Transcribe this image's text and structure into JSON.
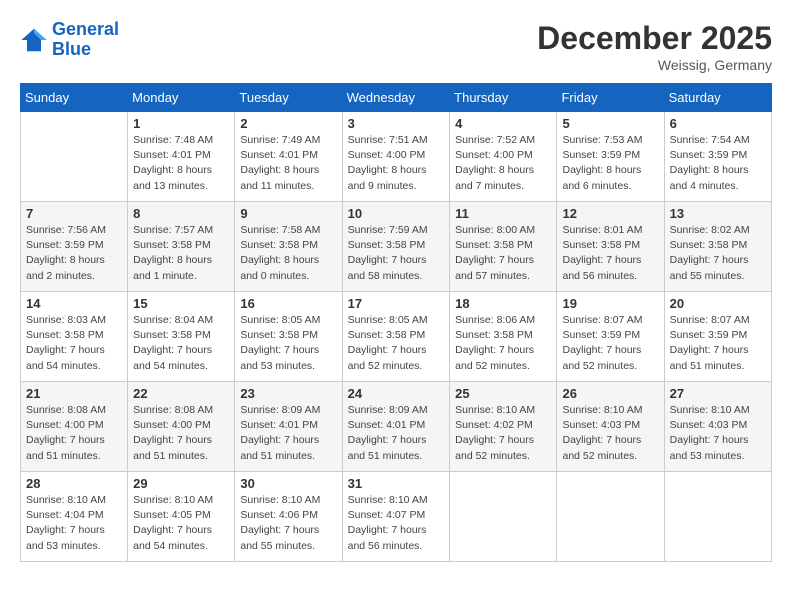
{
  "logo": {
    "line1": "General",
    "line2": "Blue"
  },
  "title": "December 2025",
  "subtitle": "Weissig, Germany",
  "days_of_week": [
    "Sunday",
    "Monday",
    "Tuesday",
    "Wednesday",
    "Thursday",
    "Friday",
    "Saturday"
  ],
  "weeks": [
    [
      {
        "day": "",
        "info": ""
      },
      {
        "day": "1",
        "info": "Sunrise: 7:48 AM\nSunset: 4:01 PM\nDaylight: 8 hours\nand 13 minutes."
      },
      {
        "day": "2",
        "info": "Sunrise: 7:49 AM\nSunset: 4:01 PM\nDaylight: 8 hours\nand 11 minutes."
      },
      {
        "day": "3",
        "info": "Sunrise: 7:51 AM\nSunset: 4:00 PM\nDaylight: 8 hours\nand 9 minutes."
      },
      {
        "day": "4",
        "info": "Sunrise: 7:52 AM\nSunset: 4:00 PM\nDaylight: 8 hours\nand 7 minutes."
      },
      {
        "day": "5",
        "info": "Sunrise: 7:53 AM\nSunset: 3:59 PM\nDaylight: 8 hours\nand 6 minutes."
      },
      {
        "day": "6",
        "info": "Sunrise: 7:54 AM\nSunset: 3:59 PM\nDaylight: 8 hours\nand 4 minutes."
      }
    ],
    [
      {
        "day": "7",
        "info": "Sunrise: 7:56 AM\nSunset: 3:59 PM\nDaylight: 8 hours\nand 2 minutes."
      },
      {
        "day": "8",
        "info": "Sunrise: 7:57 AM\nSunset: 3:58 PM\nDaylight: 8 hours\nand 1 minute."
      },
      {
        "day": "9",
        "info": "Sunrise: 7:58 AM\nSunset: 3:58 PM\nDaylight: 8 hours\nand 0 minutes."
      },
      {
        "day": "10",
        "info": "Sunrise: 7:59 AM\nSunset: 3:58 PM\nDaylight: 7 hours\nand 58 minutes."
      },
      {
        "day": "11",
        "info": "Sunrise: 8:00 AM\nSunset: 3:58 PM\nDaylight: 7 hours\nand 57 minutes."
      },
      {
        "day": "12",
        "info": "Sunrise: 8:01 AM\nSunset: 3:58 PM\nDaylight: 7 hours\nand 56 minutes."
      },
      {
        "day": "13",
        "info": "Sunrise: 8:02 AM\nSunset: 3:58 PM\nDaylight: 7 hours\nand 55 minutes."
      }
    ],
    [
      {
        "day": "14",
        "info": "Sunrise: 8:03 AM\nSunset: 3:58 PM\nDaylight: 7 hours\nand 54 minutes."
      },
      {
        "day": "15",
        "info": "Sunrise: 8:04 AM\nSunset: 3:58 PM\nDaylight: 7 hours\nand 54 minutes."
      },
      {
        "day": "16",
        "info": "Sunrise: 8:05 AM\nSunset: 3:58 PM\nDaylight: 7 hours\nand 53 minutes."
      },
      {
        "day": "17",
        "info": "Sunrise: 8:05 AM\nSunset: 3:58 PM\nDaylight: 7 hours\nand 52 minutes."
      },
      {
        "day": "18",
        "info": "Sunrise: 8:06 AM\nSunset: 3:58 PM\nDaylight: 7 hours\nand 52 minutes."
      },
      {
        "day": "19",
        "info": "Sunrise: 8:07 AM\nSunset: 3:59 PM\nDaylight: 7 hours\nand 52 minutes."
      },
      {
        "day": "20",
        "info": "Sunrise: 8:07 AM\nSunset: 3:59 PM\nDaylight: 7 hours\nand 51 minutes."
      }
    ],
    [
      {
        "day": "21",
        "info": "Sunrise: 8:08 AM\nSunset: 4:00 PM\nDaylight: 7 hours\nand 51 minutes."
      },
      {
        "day": "22",
        "info": "Sunrise: 8:08 AM\nSunset: 4:00 PM\nDaylight: 7 hours\nand 51 minutes."
      },
      {
        "day": "23",
        "info": "Sunrise: 8:09 AM\nSunset: 4:01 PM\nDaylight: 7 hours\nand 51 minutes."
      },
      {
        "day": "24",
        "info": "Sunrise: 8:09 AM\nSunset: 4:01 PM\nDaylight: 7 hours\nand 51 minutes."
      },
      {
        "day": "25",
        "info": "Sunrise: 8:10 AM\nSunset: 4:02 PM\nDaylight: 7 hours\nand 52 minutes."
      },
      {
        "day": "26",
        "info": "Sunrise: 8:10 AM\nSunset: 4:03 PM\nDaylight: 7 hours\nand 52 minutes."
      },
      {
        "day": "27",
        "info": "Sunrise: 8:10 AM\nSunset: 4:03 PM\nDaylight: 7 hours\nand 53 minutes."
      }
    ],
    [
      {
        "day": "28",
        "info": "Sunrise: 8:10 AM\nSunset: 4:04 PM\nDaylight: 7 hours\nand 53 minutes."
      },
      {
        "day": "29",
        "info": "Sunrise: 8:10 AM\nSunset: 4:05 PM\nDaylight: 7 hours\nand 54 minutes."
      },
      {
        "day": "30",
        "info": "Sunrise: 8:10 AM\nSunset: 4:06 PM\nDaylight: 7 hours\nand 55 minutes."
      },
      {
        "day": "31",
        "info": "Sunrise: 8:10 AM\nSunset: 4:07 PM\nDaylight: 7 hours\nand 56 minutes."
      },
      {
        "day": "",
        "info": ""
      },
      {
        "day": "",
        "info": ""
      },
      {
        "day": "",
        "info": ""
      }
    ]
  ]
}
